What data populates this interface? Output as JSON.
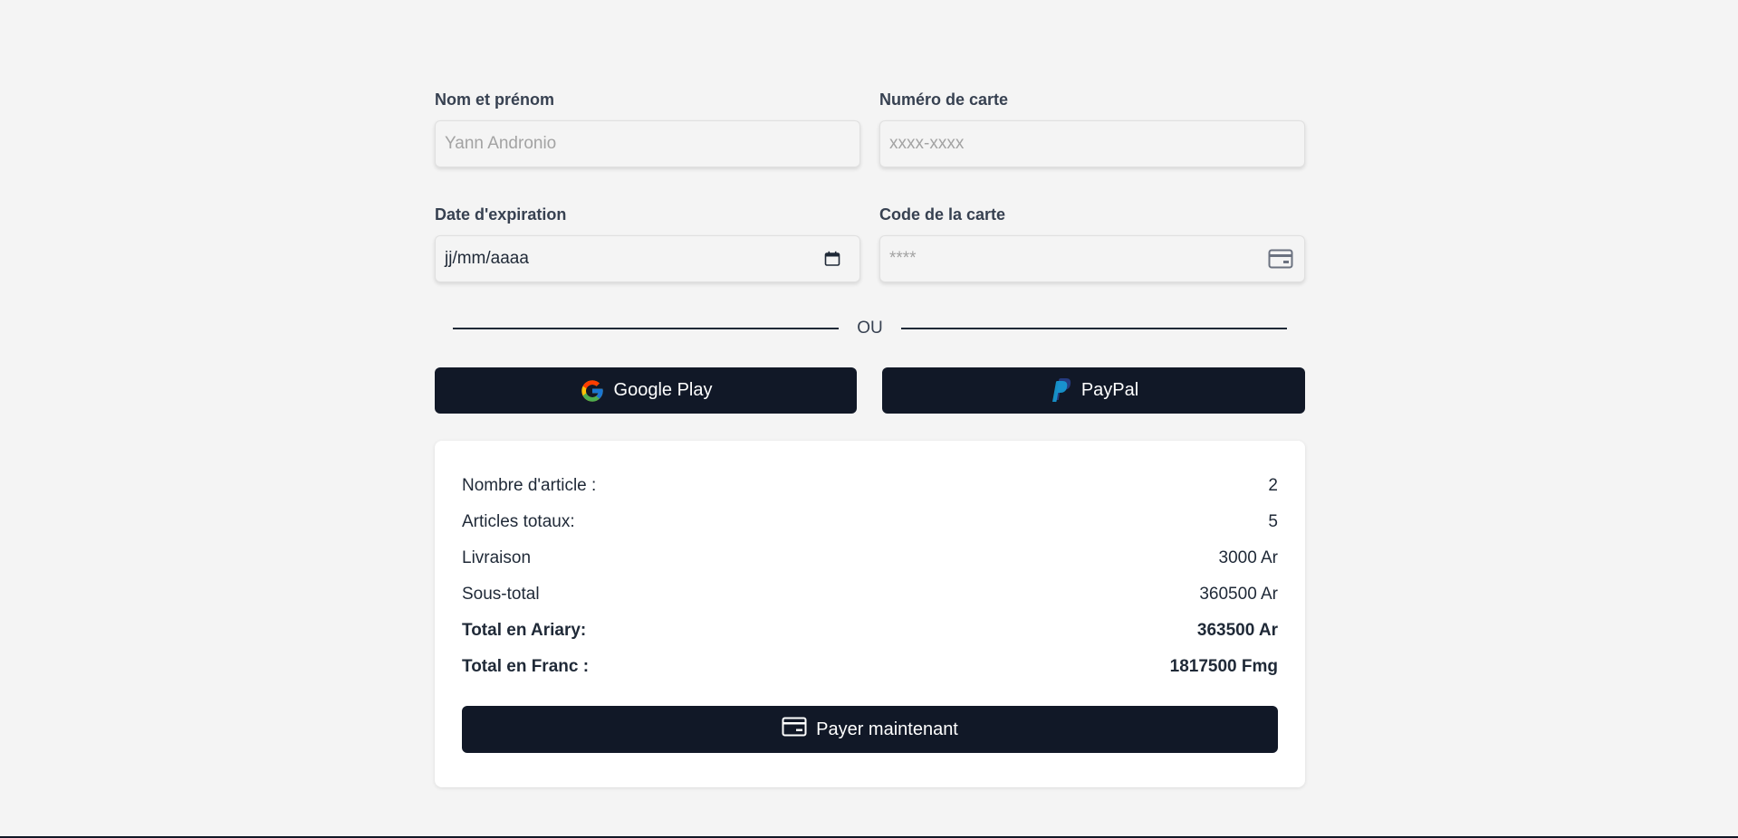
{
  "form": {
    "name": {
      "label": "Nom et prénom",
      "placeholder": "Yann Andronio",
      "value": ""
    },
    "card_number": {
      "label": "Numéro de carte",
      "placeholder": "xxxx-xxxx",
      "value": ""
    },
    "expiration": {
      "label": "Date d'expiration",
      "value": "jj/mm/aaaa",
      "icon": "calendar-icon"
    },
    "card_code": {
      "label": "Code de la carte",
      "placeholder": "****",
      "value": "",
      "icon": "credit-card-icon"
    }
  },
  "divider": {
    "text": "OU"
  },
  "alt_payments": {
    "google": {
      "label": "Google Play",
      "icon": "google-icon"
    },
    "paypal": {
      "label": "PayPal",
      "icon": "paypal-icon"
    }
  },
  "summary": {
    "rows": [
      {
        "label": "Nombre d'article :",
        "value": "2",
        "bold": false
      },
      {
        "label": "Articles totaux:",
        "value": "5",
        "bold": false
      },
      {
        "label": "Livraison",
        "value": "3000 Ar",
        "bold": false
      },
      {
        "label": "Sous-total",
        "value": "360500 Ar",
        "bold": false
      },
      {
        "label": "Total en Ariary:",
        "value": "363500 Ar",
        "bold": true
      },
      {
        "label": "Total en Franc :",
        "value": "1817500 Fmg",
        "bold": true
      }
    ],
    "pay_button": {
      "label": "Payer maintenant",
      "icon": "credit-card-icon"
    }
  },
  "colors": {
    "background": "#f4f4f4",
    "button_bg": "#111827",
    "button_text": "#ffffff",
    "card_bg": "#ffffff",
    "text": "#1f2937"
  }
}
